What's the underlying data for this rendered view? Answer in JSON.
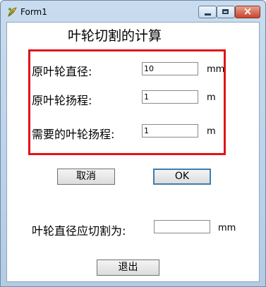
{
  "window": {
    "title": "Form1",
    "icon": "leaf-app-icon",
    "controls": [
      "minimize",
      "maximize",
      "close"
    ],
    "close_glyph": "×"
  },
  "form": {
    "heading": "叶轮切割的计算",
    "fields": [
      {
        "label": "原叶轮直径:",
        "value": "10",
        "unit": "mm"
      },
      {
        "label": "原叶轮扬程:",
        "value": "1",
        "unit": "m"
      },
      {
        "label": "需要的叶轮扬程:",
        "value": "1",
        "unit": "m"
      }
    ],
    "cancel_label": "取消",
    "ok_label": "OK",
    "result": {
      "label": "叶轮直径应切割为:",
      "value": "",
      "unit": "mm"
    },
    "exit_label": "退出"
  },
  "colors": {
    "highlight_border": "#e0141a",
    "titlebar": "#c9dcef",
    "close_button": "#c8452e"
  }
}
